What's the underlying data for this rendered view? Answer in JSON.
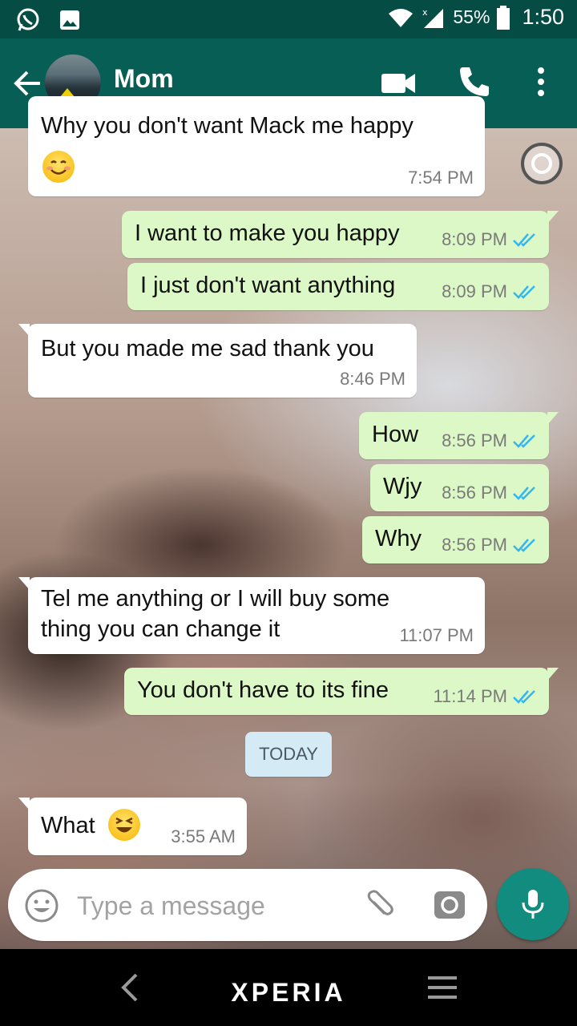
{
  "status_bar": {
    "battery_percent": "55%",
    "time": "1:50"
  },
  "header": {
    "contact_name": "Mom"
  },
  "messages": [
    {
      "direction": "in",
      "text": "Why you don't want Mack me happy",
      "emoji": "smiling-face",
      "time": "7:54 PM"
    },
    {
      "direction": "out",
      "text": "I want to make you happy",
      "time": "8:09 PM",
      "status": "read"
    },
    {
      "direction": "out",
      "text": "I just don't want anything",
      "time": "8:09 PM",
      "status": "read"
    },
    {
      "direction": "in",
      "text": "But you made me sad thank you",
      "time": "8:46 PM"
    },
    {
      "direction": "out",
      "text": "How",
      "time": "8:56 PM",
      "status": "read"
    },
    {
      "direction": "out",
      "text": "Wjy",
      "time": "8:56 PM",
      "status": "read"
    },
    {
      "direction": "out",
      "text": "Why",
      "time": "8:56 PM",
      "status": "read"
    },
    {
      "direction": "in",
      "text_line1": "Tel me anything or I will buy some",
      "text_line2": "thing you can change it",
      "time": "11:07 PM"
    },
    {
      "direction": "out",
      "text": "You don't have to its fine",
      "time": "11:14 PM",
      "status": "read"
    },
    {
      "direction": "in",
      "text": "What",
      "emoji": "grinning-squinting-face",
      "time": "3:55 AM"
    }
  ],
  "date_divider": "TODAY",
  "composer": {
    "placeholder": "Type a message",
    "value": ""
  },
  "nav_bar": {
    "brand": "XPERIA"
  },
  "colors": {
    "header": "#075e54",
    "status_bar": "#054d44",
    "outgoing_bubble": "#dcf8c6",
    "incoming_bubble": "#ffffff",
    "read_ticks": "#34b7f1",
    "mic_button": "#128c7e"
  }
}
